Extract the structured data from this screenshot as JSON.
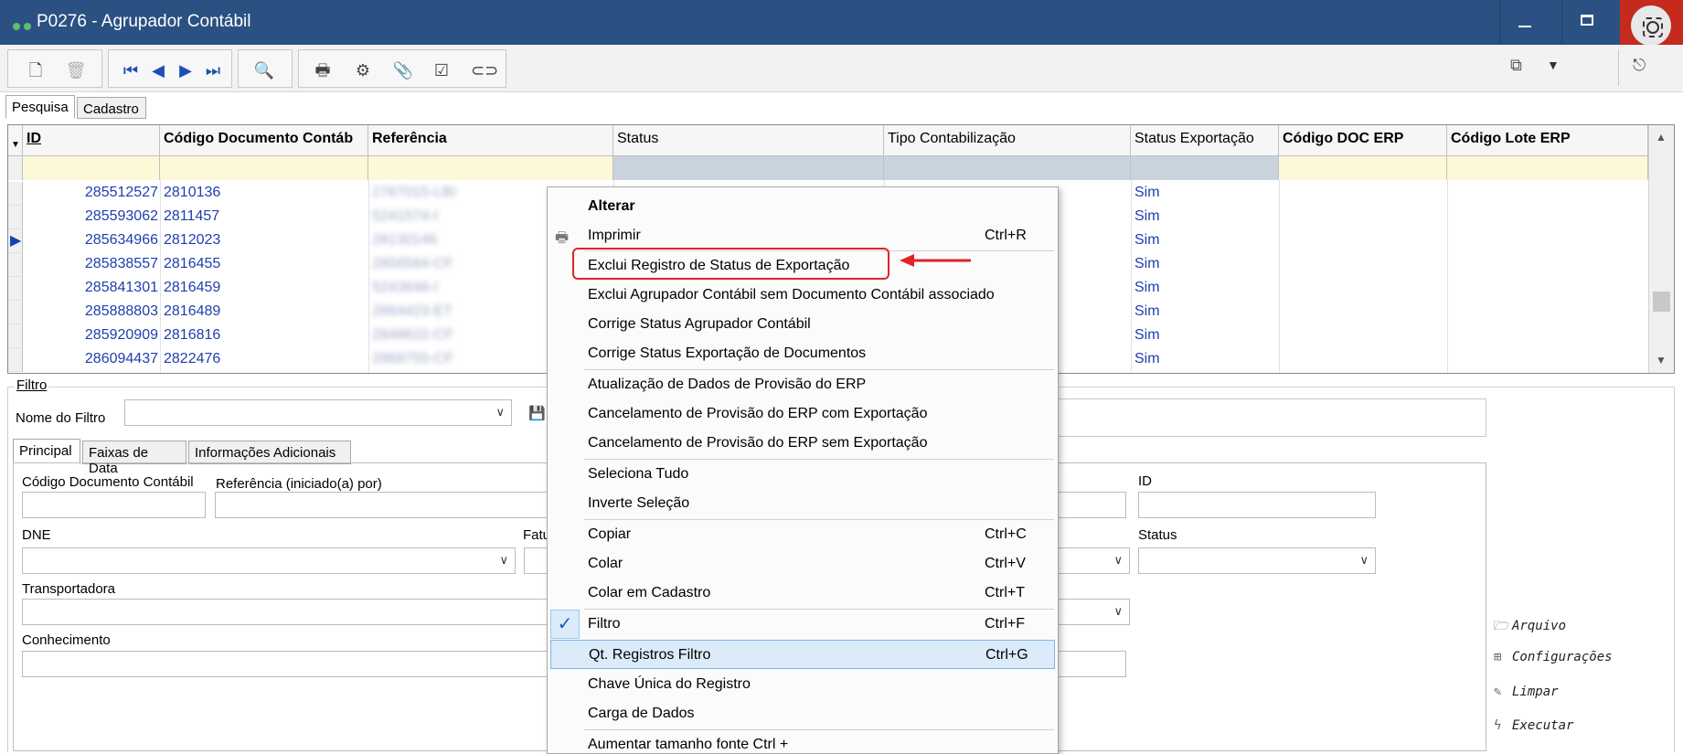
{
  "window": {
    "title": "P0276 - Agrupador Contábil"
  },
  "toolbar": {
    "icons": [
      "new-icon",
      "delete-icon",
      "first-icon",
      "prev-icon",
      "next-icon",
      "last-icon",
      "search-icon",
      "print-icon",
      "gear-icon",
      "attach-icon",
      "check-icon",
      "link-icon",
      "export-icon",
      "dropdown-icon",
      "exit-icon"
    ]
  },
  "tabs": {
    "pesquisa": "Pesquisa",
    "cadastro": "Cadastro"
  },
  "grid": {
    "columns": [
      "ID",
      "Código Documento Contáb",
      "Referência",
      "Status",
      "Tipo Contabilização",
      "Status Exportação",
      "Código DOC ERP",
      "Código Lote ERP"
    ],
    "rows": [
      {
        "id": "285512527",
        "codigo": "2810136",
        "referencia": "2767015-LBI",
        "status_exp": "Sim"
      },
      {
        "id": "285593062",
        "codigo": "2811457",
        "referencia": "5241574-I",
        "status_exp": "Sim"
      },
      {
        "id": "285634966",
        "codigo": "2812023",
        "referencia": "28130146",
        "status_exp": "Sim"
      },
      {
        "id": "285838557",
        "codigo": "2816455",
        "referencia": "2856564-CF",
        "status_exp": "Sim"
      },
      {
        "id": "285841301",
        "codigo": "2816459",
        "referencia": "5243646-I",
        "status_exp": "Sim"
      },
      {
        "id": "285888803",
        "codigo": "2816489",
        "referencia": "2864423-ET",
        "status_exp": "Sim"
      },
      {
        "id": "285920909",
        "codigo": "2816816",
        "referencia": "2848622-CF",
        "status_exp": "Sim"
      },
      {
        "id": "286094437",
        "codigo": "2822476",
        "referencia": "2868755-CF",
        "status_exp": "Sim"
      }
    ]
  },
  "filtro": {
    "legend": "Filtro",
    "nome_label": "Nome do Filtro",
    "nome_value": "",
    "tabs": [
      "Principal",
      "Faixas de Data",
      "Informações Adicionais"
    ],
    "fields": {
      "codigo_doc": "Código Documento Contábil",
      "referencia": "Referência (iniciado(a) por)",
      "id": "ID",
      "dne": "DNE",
      "fatu": "Fatu",
      "status": "Status",
      "transportadora": "Transportadora",
      "conhecimento": "Conhecimento"
    },
    "side_actions": [
      "Arquivo",
      "Configurações",
      "Limpar",
      "Executar"
    ]
  },
  "context_menu": {
    "items": [
      {
        "label": "Alterar",
        "shortcut": ""
      },
      {
        "label": "Imprimir",
        "shortcut": "Ctrl+R"
      },
      {
        "label": "Exclui Registro de Status de Exportação",
        "shortcut": ""
      },
      {
        "label": "Exclui Agrupador Contábil sem Documento Contábil associado",
        "shortcut": ""
      },
      {
        "label": "Corrige Status Agrupador Contábil",
        "shortcut": ""
      },
      {
        "label": "Corrige Status Exportação de Documentos",
        "shortcut": ""
      },
      {
        "label": "Atualização de Dados de Provisão do ERP",
        "shortcut": ""
      },
      {
        "label": "Cancelamento de Provisão do ERP com Exportação",
        "shortcut": ""
      },
      {
        "label": "Cancelamento de Provisão do ERP sem Exportação",
        "shortcut": ""
      },
      {
        "label": "Seleciona Tudo",
        "shortcut": ""
      },
      {
        "label": "Inverte Seleção",
        "shortcut": ""
      },
      {
        "label": "Copiar",
        "shortcut": "Ctrl+C"
      },
      {
        "label": "Colar",
        "shortcut": "Ctrl+V"
      },
      {
        "label": "Colar em Cadastro",
        "shortcut": "Ctrl+T"
      },
      {
        "label": "Filtro",
        "shortcut": "Ctrl+F"
      },
      {
        "label": "Qt. Registros Filtro",
        "shortcut": "Ctrl+G"
      },
      {
        "label": "Chave Única do Registro",
        "shortcut": ""
      },
      {
        "label": "Carga de Dados",
        "shortcut": ""
      },
      {
        "label": "Aumentar tamanho fonte  Ctrl +",
        "shortcut": ""
      }
    ]
  },
  "colors": {
    "titlebar": "#2a5182",
    "link_blue": "#1f3eae",
    "highlight_red": "#e0242a",
    "filter_row_yellow": "#fdf8d8",
    "menu_hover": "#dcebfa"
  }
}
